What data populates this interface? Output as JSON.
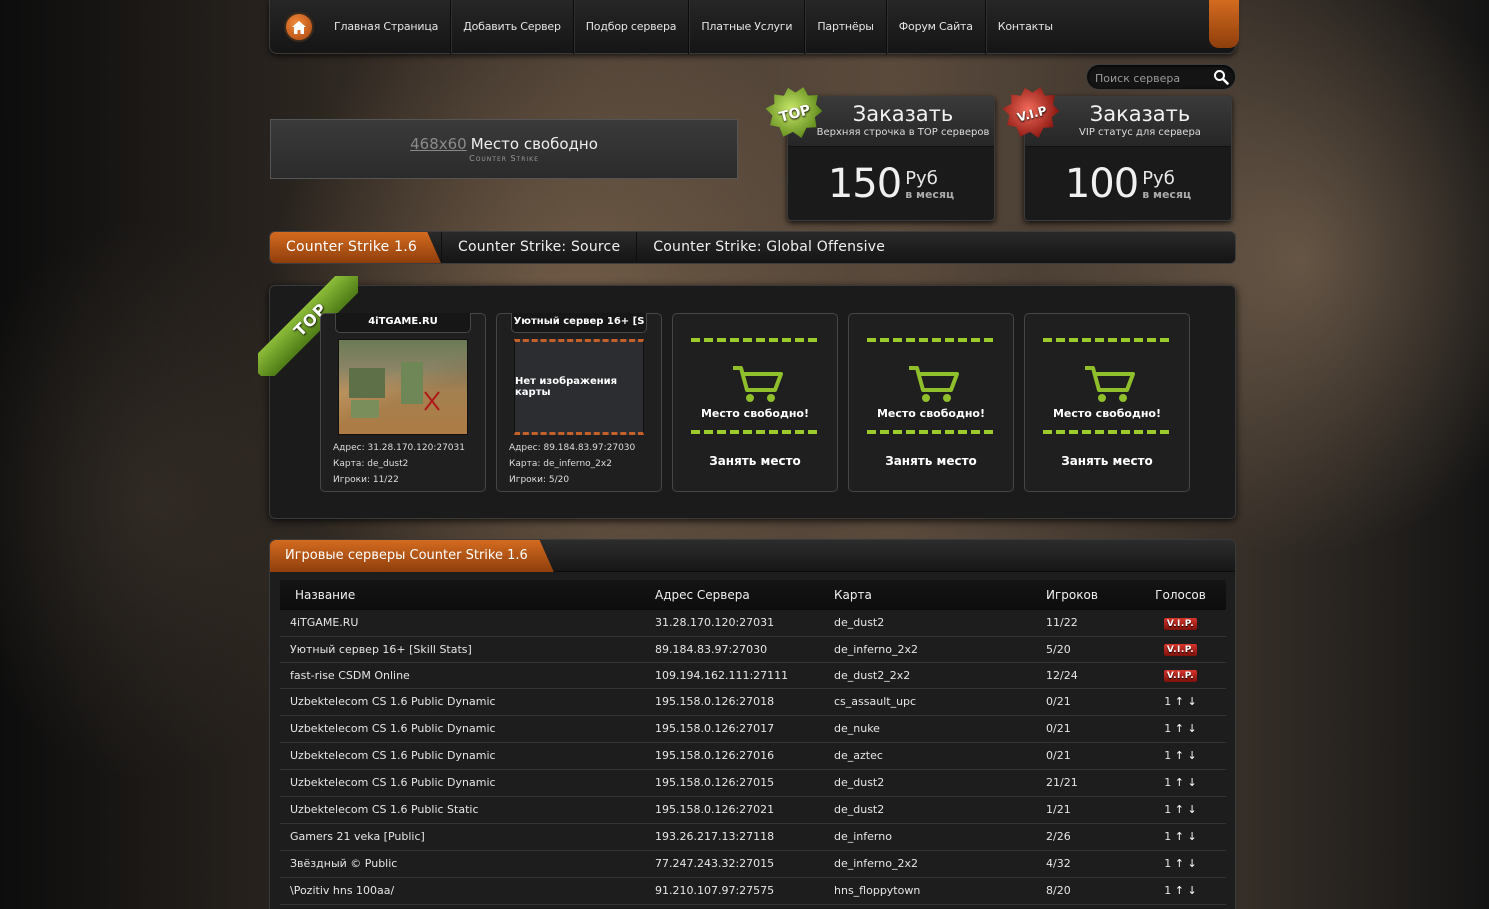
{
  "nav": {
    "items": [
      "Главная Страница",
      "Добавить Сервер",
      "Подбор сервера",
      "Платные Услуги",
      "Партнёры",
      "Форум Сайта",
      "Контакты"
    ]
  },
  "search": {
    "placeholder": "Поиск сервера"
  },
  "ad": {
    "size": "468x60",
    "text": "Место свободно",
    "logo": "Counter Strike"
  },
  "orders": {
    "top": {
      "badge": "TOP",
      "title": "Заказать",
      "subtitle": "Верхняя строчка в TOP серверов",
      "price": "150",
      "currency": "Руб",
      "period": "в месяц"
    },
    "vip": {
      "badge": "V.I.P",
      "title": "Заказать",
      "subtitle": "VIP статус для сервера",
      "price": "100",
      "currency": "Руб",
      "period": "в месяц"
    }
  },
  "game_tabs": [
    "Counter Strike 1.6",
    "Counter Strike: Source",
    "Counter Strike: Global Offensive"
  ],
  "top_panel": {
    "ribbon": "TOP",
    "servers": [
      {
        "name": "4iTGAME.RU",
        "address": "Адрес: 31.28.170.120:27031",
        "map": "Карта: de_dust2",
        "players": "Игроки: 11/22"
      },
      {
        "name": "Уютный сервер 16+ [S",
        "no_image": "Нет изображения карты",
        "address": "Адрес: 89.184.83.97:27030",
        "map": "Карта: de_inferno_2x2",
        "players": "Игроки: 5/20"
      }
    ],
    "free_slots": [
      {
        "text": "Место свободно!",
        "button": "Занять место"
      },
      {
        "text": "Место свободно!",
        "button": "Занять место"
      },
      {
        "text": "Место свободно!",
        "button": "Занять место"
      }
    ]
  },
  "server_list": {
    "title": "Игровые серверы Counter Strike 1.6",
    "columns": [
      "Название",
      "Адрес Сервера",
      "Карта",
      "Игроков",
      "Голосов"
    ],
    "rows": [
      {
        "name": "4iTGAME.RU",
        "address": "31.28.170.120:27031",
        "map": "de_dust2",
        "players": "11/22",
        "vote": "V.I.P."
      },
      {
        "name": "Уютный сервер 16+ [Skill Stats]",
        "address": "89.184.83.97:27030",
        "map": "de_inferno_2x2",
        "players": "5/20",
        "vote": "V.I.P."
      },
      {
        "name": "fast-rise CSDM Online",
        "address": "109.194.162.111:27111",
        "map": "de_dust2_2x2",
        "players": "12/24",
        "vote": "V.I.P."
      },
      {
        "name": "Uzbektelecom CS 1.6 Public Dynamic",
        "address": "195.158.0.126:27018",
        "map": "cs_assault_upc",
        "players": "0/21",
        "vote": "1"
      },
      {
        "name": "Uzbektelecom CS 1.6 Public Dynamic",
        "address": "195.158.0.126:27017",
        "map": "de_nuke",
        "players": "0/21",
        "vote": "1"
      },
      {
        "name": "Uzbektelecom CS 1.6 Public Dynamic",
        "address": "195.158.0.126:27016",
        "map": "de_aztec",
        "players": "0/21",
        "vote": "1"
      },
      {
        "name": "Uzbektelecom CS 1.6 Public Dynamic",
        "address": "195.158.0.126:27015",
        "map": "de_dust2",
        "players": "21/21",
        "vote": "1"
      },
      {
        "name": "Uzbektelecom CS 1.6 Public Static",
        "address": "195.158.0.126:27021",
        "map": "de_dust2",
        "players": "1/21",
        "vote": "1"
      },
      {
        "name": "Gamers 21 veka [Public]",
        "address": "193.26.217.13:27118",
        "map": "de_inferno",
        "players": "2/26",
        "vote": "1"
      },
      {
        "name": "Звёздный © Public",
        "address": "77.247.243.32:27015",
        "map": "de_inferno_2x2",
        "players": "4/32",
        "vote": "1"
      },
      {
        "name": "\\Pozitiv hns 100aa/",
        "address": "91.210.107.97:27575",
        "map": "hns_floppytown",
        "players": "8/20",
        "vote": "1"
      }
    ],
    "up_arrow": "↑",
    "down_arrow": "↓"
  }
}
